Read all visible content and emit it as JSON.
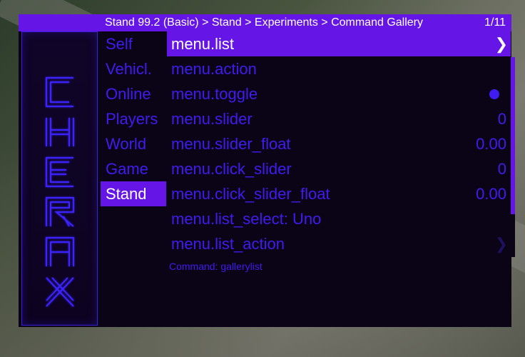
{
  "header": {
    "breadcrumb": "Stand 99.2 (Basic) > Stand > Experiments > Command Gallery",
    "page_counter": "1/11"
  },
  "logo": {
    "text": "CHERAX"
  },
  "nav": {
    "items": [
      {
        "label": "Self"
      },
      {
        "label": "Vehicl."
      },
      {
        "label": "Online"
      },
      {
        "label": "Players"
      },
      {
        "label": "World"
      },
      {
        "label": "Game"
      },
      {
        "label": "Stand"
      }
    ],
    "active": "Stand"
  },
  "commands": [
    {
      "label": "menu.list",
      "value": "",
      "icon": "chevron-right-icon"
    },
    {
      "label": "menu.action",
      "value": ""
    },
    {
      "label": "menu.toggle",
      "value": "",
      "icon": "toggle-dot-icon"
    },
    {
      "label": "menu.slider",
      "value": "0"
    },
    {
      "label": "menu.slider_float",
      "value": "0.00"
    },
    {
      "label": "menu.click_slider",
      "value": "0"
    },
    {
      "label": "menu.click_slider_float",
      "value": "0.00"
    },
    {
      "label": "menu.list_select: Uno",
      "value": ""
    },
    {
      "label": "menu.list_action",
      "value": "",
      "icon": "chevron-right-icon"
    }
  ],
  "info": {
    "command_hint": "Command: gallerylist"
  },
  "colors": {
    "accent": "#6515e6",
    "text": "#3f1cf0",
    "panel": "#0b0316"
  }
}
